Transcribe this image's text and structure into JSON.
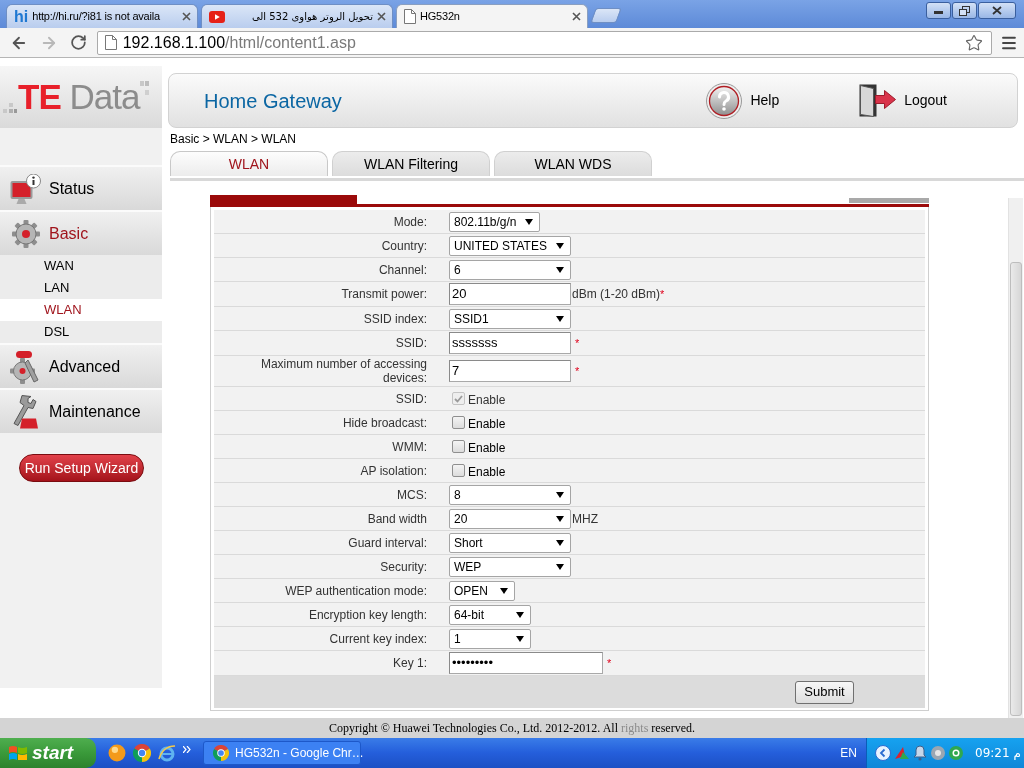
{
  "browser": {
    "tabs": [
      {
        "title": "http://hi.ru/?i81 is not availa",
        "icon_text": "hi",
        "selected": false
      },
      {
        "title": "تحويل الروتر هواوى 532 الى",
        "selected": false
      },
      {
        "title": "HG532n",
        "selected": true
      }
    ],
    "address": {
      "host": "192.168.1.100",
      "path": "/html/content1.asp"
    }
  },
  "sidebar": {
    "logo": {
      "part_1": "TE",
      "part_2": "Data"
    },
    "menu": [
      {
        "label": "Status",
        "selected": false
      },
      {
        "label": "Basic",
        "selected": true,
        "children": [
          {
            "label": "WAN",
            "selected": false
          },
          {
            "label": "LAN",
            "selected": false
          },
          {
            "label": "WLAN",
            "selected": true
          },
          {
            "label": "DSL",
            "selected": false
          }
        ]
      },
      {
        "label": "Advanced",
        "selected": false
      },
      {
        "label": "Maintenance",
        "selected": false
      }
    ],
    "wizard_button": "Run Setup Wizard"
  },
  "header": {
    "title": "Home Gateway",
    "links": [
      {
        "label": "Help"
      },
      {
        "label": "Logout"
      }
    ]
  },
  "breadcrumb": "Basic > WLAN > WLAN",
  "tabs": [
    {
      "label": "WLAN",
      "selected": true
    },
    {
      "label": "WLAN Filtering",
      "selected": false
    },
    {
      "label": "WLAN WDS",
      "selected": false
    }
  ],
  "form": {
    "rows": [
      {
        "kind": "select",
        "label": "Mode:",
        "value": "802.11b/g/n"
      },
      {
        "kind": "select",
        "label": "Country:",
        "value": "UNITED STATES"
      },
      {
        "kind": "select",
        "label": "Channel:",
        "value": "6"
      },
      {
        "kind": "text",
        "label": "Transmit power:",
        "value": "20",
        "suffix": "dBm (1-20 dBm)",
        "mark": "*"
      },
      {
        "kind": "select",
        "label": "SSID index:",
        "value": "SSID1"
      },
      {
        "kind": "text",
        "label": "SSID:",
        "value": "sssssss",
        "mark": "*"
      },
      {
        "kind": "text",
        "label": "Maximum number of accessing devices:",
        "value": "7",
        "mark": "*"
      },
      {
        "kind": "checkbox",
        "label": "SSID:",
        "option": "Enable",
        "checked": true,
        "disabled": true
      },
      {
        "kind": "checkbox",
        "label": "Hide broadcast:",
        "option": "Enable",
        "checked": false,
        "disabled": false
      },
      {
        "kind": "checkbox",
        "label": "WMM:",
        "option": "Enable",
        "checked": false,
        "disabled": false
      },
      {
        "kind": "checkbox",
        "label": "AP isolation:",
        "option": "Enable",
        "checked": false,
        "disabled": false
      },
      {
        "kind": "select",
        "label": "MCS:",
        "value": "8"
      },
      {
        "kind": "select",
        "label": "Band width",
        "value": "20",
        "suffix": "MHZ"
      },
      {
        "kind": "select",
        "label": "Guard interval:",
        "value": "Short"
      },
      {
        "kind": "select",
        "label": "Security:",
        "value": "WEP"
      },
      {
        "kind": "select",
        "label": "WEP authentication mode:",
        "value": "OPEN"
      },
      {
        "kind": "select",
        "label": "Encryption key length:",
        "value": "64-bit"
      },
      {
        "kind": "select",
        "label": "Current key index:",
        "value": "1"
      },
      {
        "kind": "password",
        "label": "Key 1:",
        "value": "•••••••••",
        "mark": "*"
      }
    ],
    "submit": "Submit"
  },
  "footer": {
    "text_1": "Copyright © Huawei Technologies Co., Ltd. 2012-2012. All",
    "muted": "rights",
    "text_2": "reserved."
  },
  "taskbar": {
    "start": "start",
    "task": {
      "label": "HG532n - Google Chr…",
      "selected": false
    },
    "language": "EN",
    "clock": "09:21 م"
  }
}
